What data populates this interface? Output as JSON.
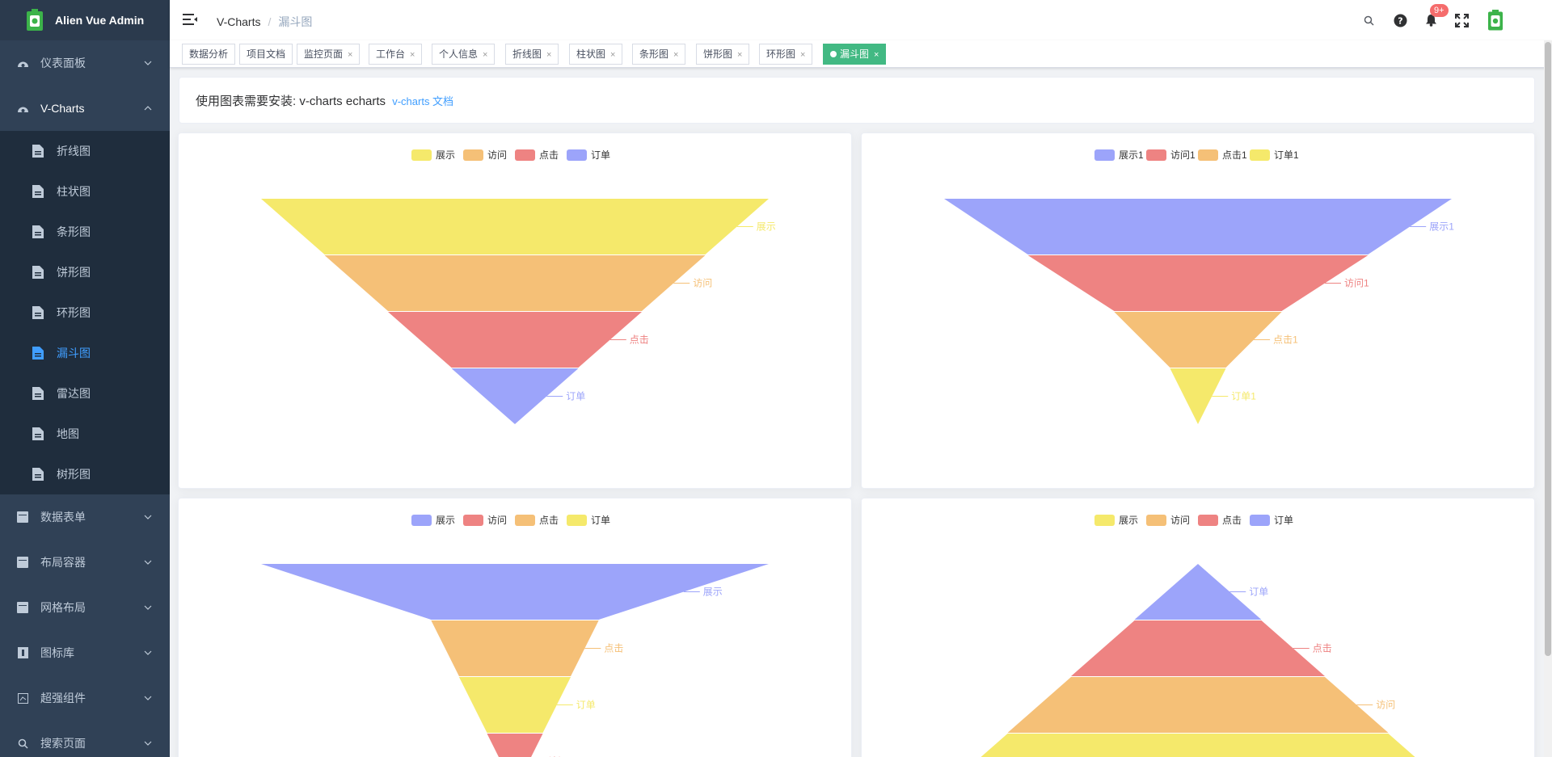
{
  "app": {
    "title": "Alien Vue Admin"
  },
  "sidebar": {
    "items": [
      {
        "label": "仪表面板",
        "icon": "dashboard-icon"
      },
      {
        "label": "V-Charts",
        "icon": "dashboard-icon",
        "expanded": true,
        "children": [
          "折线图",
          "柱状图",
          "条形图",
          "饼形图",
          "环形图",
          "漏斗图",
          "雷达图",
          "地图",
          "树形图"
        ],
        "active_child": "漏斗图"
      },
      {
        "label": "数据表单",
        "icon": "table-icon"
      },
      {
        "label": "布局容器",
        "icon": "table-icon"
      },
      {
        "label": "网格布局",
        "icon": "table-icon"
      },
      {
        "label": "图标库",
        "icon": "icon-library-icon"
      },
      {
        "label": "超强组件",
        "icon": "component-icon"
      },
      {
        "label": "搜索页面",
        "icon": "search-icon"
      }
    ]
  },
  "header": {
    "breadcrumb": [
      "V-Charts",
      "漏斗图"
    ],
    "notification_count": "9+"
  },
  "tags": [
    {
      "label": "数据分析",
      "closable": false
    },
    {
      "label": "项目文档",
      "closable": false
    },
    {
      "label": "监控页面",
      "closable": true
    },
    {
      "label": "工作台",
      "closable": true
    },
    {
      "label": "个人信息",
      "closable": true
    },
    {
      "label": "折线图",
      "closable": true
    },
    {
      "label": "柱状图",
      "closable": true
    },
    {
      "label": "条形图",
      "closable": true
    },
    {
      "label": "饼形图",
      "closable": true
    },
    {
      "label": "环形图",
      "closable": true
    },
    {
      "label": "漏斗图",
      "closable": true,
      "active": true
    }
  ],
  "info": {
    "text": "使用图表需要安装: v-charts echarts",
    "link": "v-charts 文档"
  },
  "colors": {
    "yellow": "#f5e96b",
    "orange": "#f5c077",
    "red": "#ee8382",
    "blue": "#9ca4fa",
    "accent": "#42b983",
    "link": "#409eff"
  },
  "chart_data": [
    {
      "type": "funnel",
      "sort": "descending",
      "legend": [
        "展示",
        "访问",
        "点击",
        "订单"
      ],
      "legend_colors": [
        "#f5e96b",
        "#f5c077",
        "#ee8382",
        "#9ca4fa"
      ],
      "segments": [
        {
          "name": "展示",
          "value": 100,
          "color": "#f5e96b"
        },
        {
          "name": "访问",
          "value": 75,
          "color": "#f5c077"
        },
        {
          "name": "点击",
          "value": 50,
          "color": "#ee8382"
        },
        {
          "name": "订单",
          "value": 25,
          "color": "#9ca4fa"
        }
      ]
    },
    {
      "type": "funnel",
      "sort": "descending",
      "legend": [
        "展示1",
        "访问1",
        "点击1",
        "订单1"
      ],
      "legend_colors": [
        "#9ca4fa",
        "#ee8382",
        "#f5c077",
        "#f5e96b"
      ],
      "segments": [
        {
          "name": "展示1",
          "value": 100,
          "color": "#9ca4fa"
        },
        {
          "name": "访问1",
          "value": 67,
          "color": "#ee8382"
        },
        {
          "name": "点击1",
          "value": 33,
          "color": "#f5c077"
        },
        {
          "name": "订单1",
          "value": 11,
          "color": "#f5e96b"
        }
      ]
    },
    {
      "type": "funnel",
      "sort": "descending",
      "legend": [
        "展示",
        "访问",
        "点击",
        "订单"
      ],
      "legend_colors": [
        "#9ca4fa",
        "#ee8382",
        "#f5c077",
        "#f5e96b"
      ],
      "segments": [
        {
          "name": "展示",
          "value": 100,
          "color": "#9ca4fa"
        },
        {
          "name": "点击",
          "value": 33,
          "color": "#f5c077"
        },
        {
          "name": "订单",
          "value": 22,
          "color": "#f5e96b"
        },
        {
          "name": "访问",
          "value": 11,
          "color": "#ee8382"
        }
      ]
    },
    {
      "type": "funnel",
      "sort": "ascending",
      "legend": [
        "展示",
        "访问",
        "点击",
        "订单"
      ],
      "legend_colors": [
        "#f5e96b",
        "#f5c077",
        "#ee8382",
        "#9ca4fa"
      ],
      "segments": [
        {
          "name": "订单",
          "value": 25,
          "color": "#9ca4fa"
        },
        {
          "name": "点击",
          "value": 50,
          "color": "#ee8382"
        },
        {
          "name": "访问",
          "value": 75,
          "color": "#f5c077"
        },
        {
          "name": "展示",
          "value": 100,
          "color": "#f5e96b"
        }
      ]
    }
  ]
}
